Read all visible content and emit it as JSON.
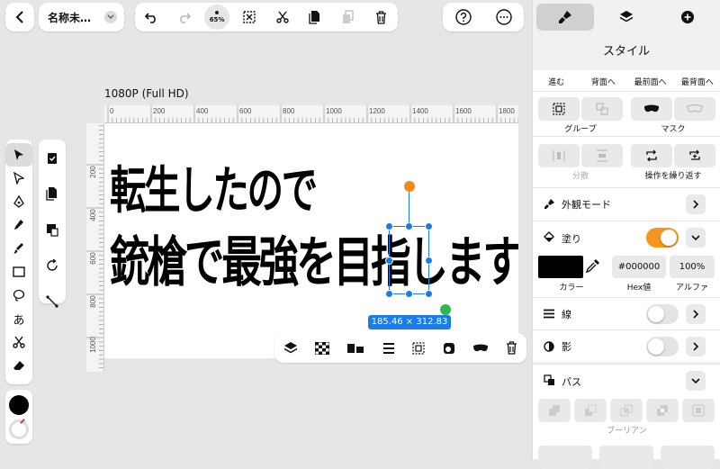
{
  "document": {
    "title": "名称未…"
  },
  "toolbar": {
    "zoom": "65%"
  },
  "canvas": {
    "preset_label": "1080P (Full HD)",
    "ruler_h": [
      "0",
      "200",
      "400",
      "600",
      "800",
      "1000",
      "1200",
      "1400",
      "1600",
      "1800"
    ],
    "ruler_v": [
      "0",
      "200",
      "400",
      "600",
      "800",
      "1000"
    ],
    "text_line1": "転生したので",
    "text_line2": "銃槍で最強を目指します",
    "selection_size": "185.46 × 312.83"
  },
  "panel": {
    "title": "スタイル",
    "arrange_labels": [
      "進む",
      "背面へ",
      "最前面へ",
      "最背面へ"
    ],
    "group_label": "グループ",
    "mask_label": "マスク",
    "distribute_label": "分散",
    "repeat_label": "操作を繰り返す",
    "appearance_label": "外観モード",
    "fill_label": "塗り",
    "fill_enabled": true,
    "fill_color": "#000000",
    "hex_value": "#000000",
    "alpha_value": "100%",
    "color_caption": "カラー",
    "hex_caption": "Hex値",
    "alpha_caption": "アルファ",
    "stroke_label": "線",
    "stroke_enabled": false,
    "shadow_label": "影",
    "shadow_enabled": false,
    "path_label": "パス",
    "boolean_label": "ブーリアン"
  },
  "colors": {
    "accent": "#f5961e",
    "selection": "#1a7ce8",
    "handle_orange": "#f08a1c",
    "handle_green": "#2db84d"
  }
}
